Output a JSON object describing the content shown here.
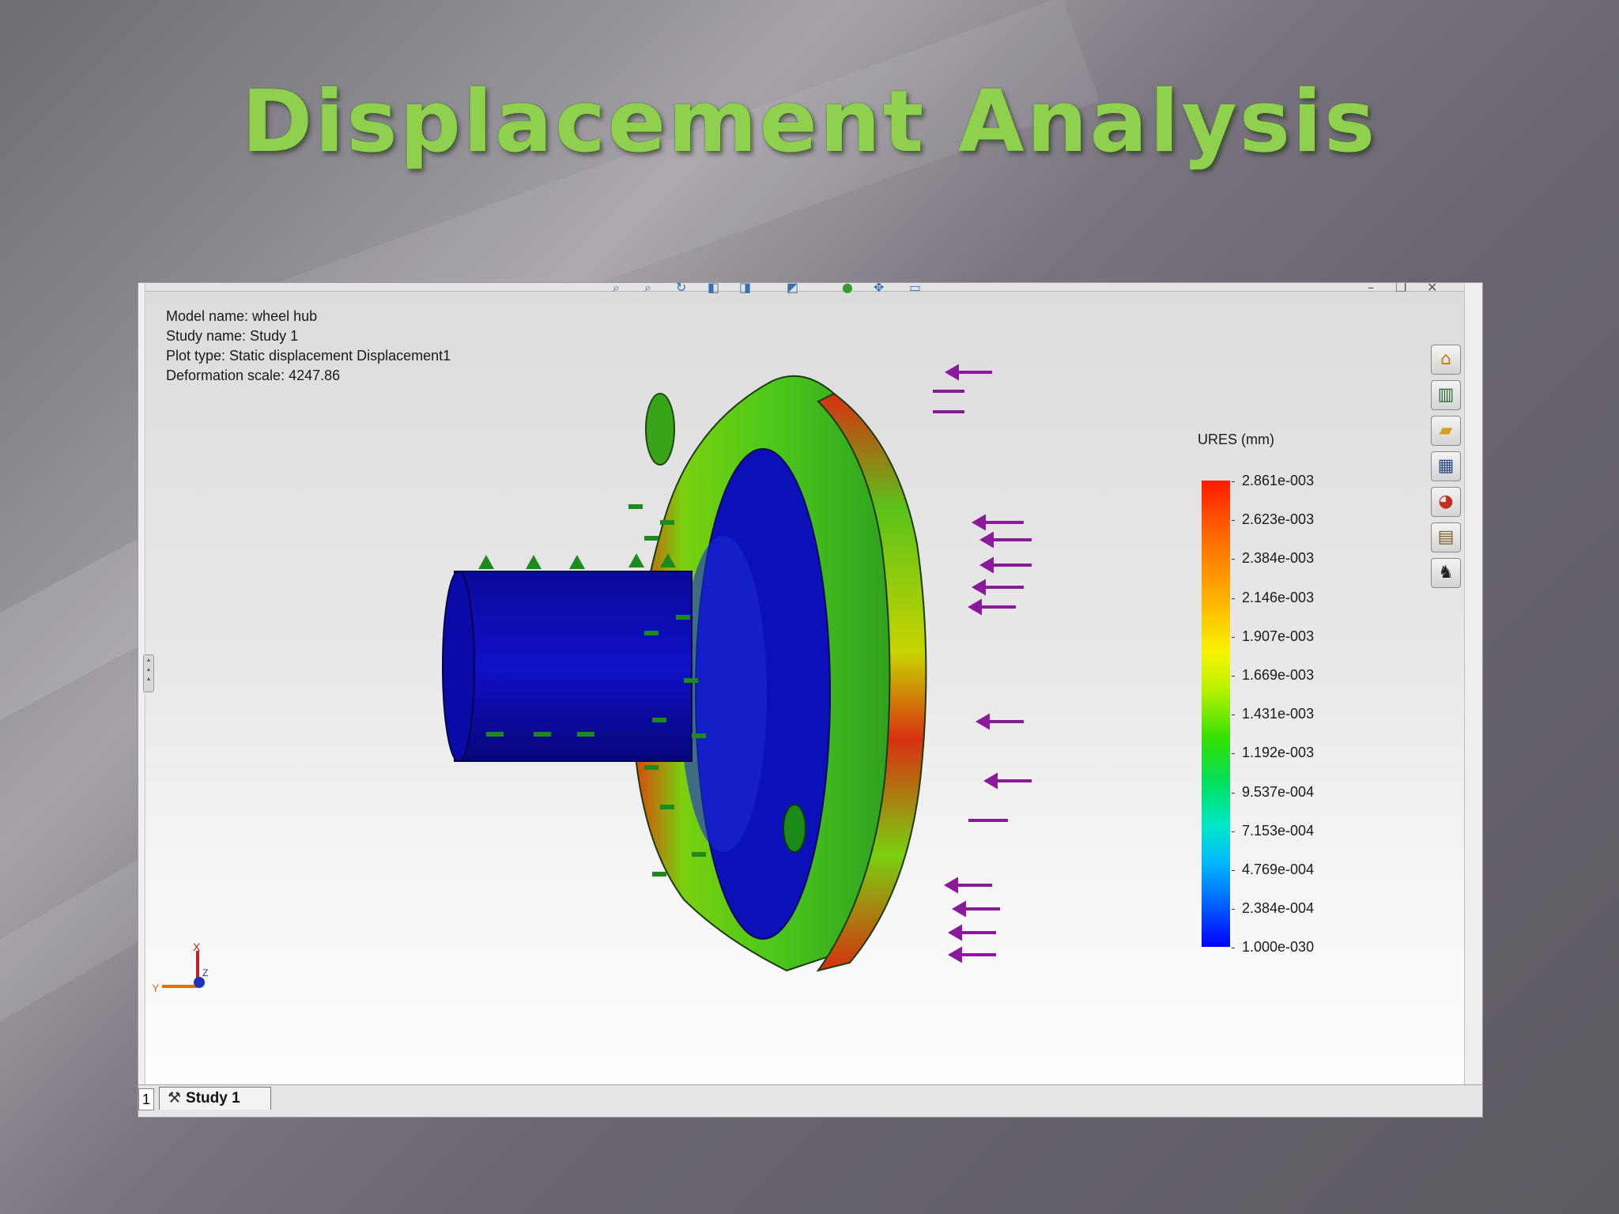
{
  "slide": {
    "title": "Displacement  Analysis"
  },
  "window": {
    "info_lines": [
      "Model name: wheel hub",
      "Study name: Study 1",
      "Plot type: Static displacement Displacement1",
      "Deformation scale: 4247.86"
    ],
    "legend": {
      "title": "URES (mm)",
      "labels": [
        "2.861e-003",
        "2.623e-003",
        "2.384e-003",
        "2.146e-003",
        "1.907e-003",
        "1.669e-003",
        "1.431e-003",
        "1.192e-003",
        "9.537e-004",
        "7.153e-004",
        "4.769e-004",
        "2.384e-004",
        "1.000e-030"
      ],
      "colors": [
        "#ff1a00",
        "#f7f400",
        "#37e000",
        "#00b8ff",
        "#0000ff"
      ]
    },
    "triad": {
      "x_label": "X",
      "y_label": "Y",
      "z_label": "Z"
    },
    "side_tools": [
      "home-icon",
      "chart-icon",
      "folder-icon",
      "table-icon",
      "color-wheel-icon",
      "report-icon",
      "presenter-icon"
    ],
    "tabs": {
      "index": "1",
      "study_label": "Study 1"
    }
  }
}
